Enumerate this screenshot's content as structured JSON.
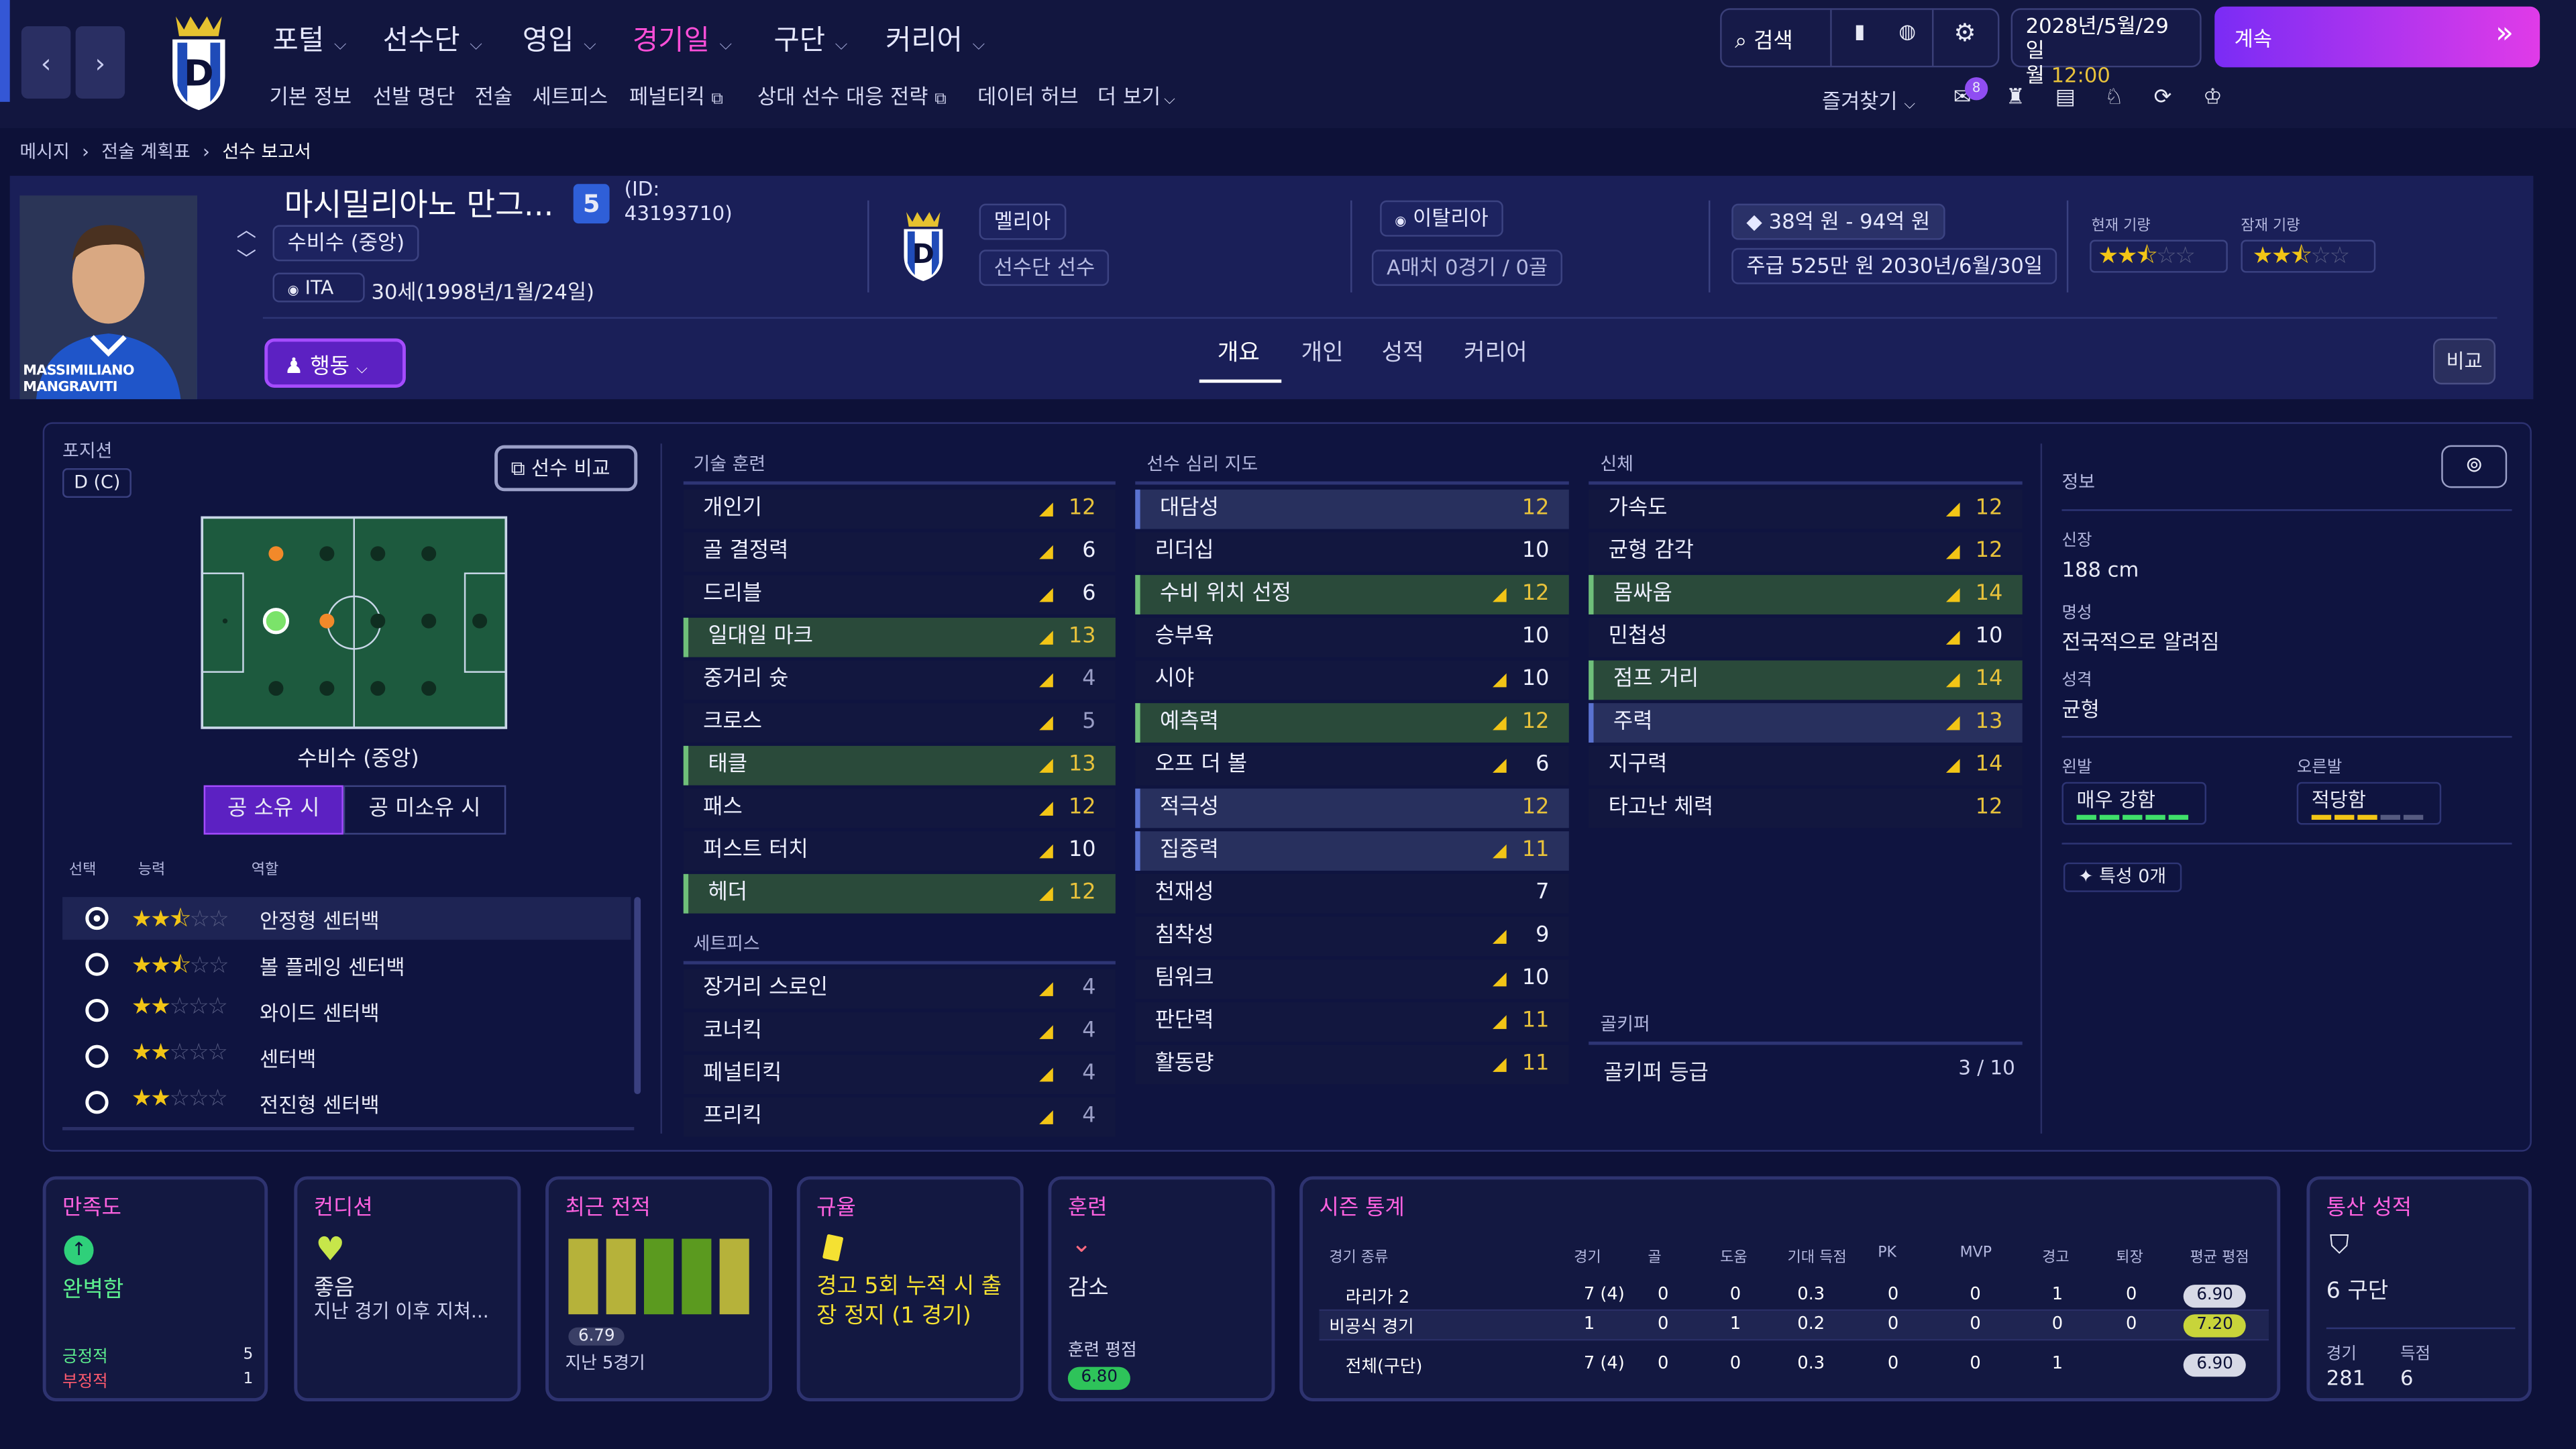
{
  "top": {
    "menus": [
      "포털",
      "선수단",
      "영입",
      "경기일",
      "구단",
      "커리어"
    ],
    "active_menu": "경기일",
    "submenus": [
      "기본 정보",
      "선발 명단",
      "전술",
      "세트피스",
      "페널티킥",
      "상대 선수 대응 전략",
      "데이터 허브",
      "더 보기"
    ],
    "search_label": "검색",
    "favorites_label": "즐겨찾기",
    "notif_count": "8",
    "date_line1": "2028년/5월/29일",
    "date_line2a": "월",
    "date_line2b": "12:00",
    "continue_label": "계속"
  },
  "breadcrumb": [
    "메시지",
    "전술 계획표",
    "선수 보고서"
  ],
  "player": {
    "name": "마시밀리아노 만그...",
    "number": "5",
    "id_label": "(ID:",
    "id_value": "43193710)",
    "position": "수비수 (중앙)",
    "nationality_code": "ITA",
    "age_birth": "30세(1998년/1월/24일)",
    "photo_caption": "MASSIMILIANO MANGRAVITI",
    "club": "멜리아",
    "club_role": "선수단 선수",
    "nation": "이탈리아",
    "caps": "A매치 0경기 / 0골",
    "value": "38억 원 - 94억 원",
    "wage": "주급 525만 원 2030년/6월/30일",
    "current_ability_label": "현재 기량",
    "potential_ability_label": "잠재 기량",
    "current_ability_stars": 2.5,
    "potential_ability_stars": 2.5,
    "action_label": "행동",
    "tabs": [
      "개요",
      "개인",
      "성적",
      "커리어"
    ],
    "active_tab": "개요",
    "compare_label": "비교"
  },
  "position_panel": {
    "title": "포지션",
    "code": "D (C)",
    "compare_button": "선수 비교",
    "position_name": "수비수 (중앙)",
    "in_possession": "공 소유 시",
    "out_possession": "공 미소유 시",
    "col_select": "선택",
    "col_ability": "능력",
    "col_role": "역할",
    "roles": [
      {
        "name": "안정형 센터백",
        "stars": 2.5,
        "selected": true
      },
      {
        "name": "볼 플레잉 센터백",
        "stars": 2.5,
        "selected": false
      },
      {
        "name": "와이드 센터백",
        "stars": 2,
        "selected": false
      },
      {
        "name": "센터백",
        "stars": 2,
        "selected": false
      },
      {
        "name": "전진형 센터백",
        "stars": 2,
        "selected": false
      }
    ]
  },
  "technical": {
    "title": "기술 훈련",
    "attrs": [
      {
        "name": "개인기",
        "value": "12",
        "trend": true,
        "hl": "none"
      },
      {
        "name": "골 결정력",
        "value": "6",
        "trend": true,
        "hl": "none"
      },
      {
        "name": "드리블",
        "value": "6",
        "trend": true,
        "hl": "none"
      },
      {
        "name": "일대일 마크",
        "value": "13",
        "trend": true,
        "hl": "green"
      },
      {
        "name": "중거리 슛",
        "value": "4",
        "trend": true,
        "hl": "none"
      },
      {
        "name": "크로스",
        "value": "5",
        "trend": true,
        "hl": "none"
      },
      {
        "name": "태클",
        "value": "13",
        "trend": true,
        "hl": "green"
      },
      {
        "name": "패스",
        "value": "12",
        "trend": true,
        "hl": "none"
      },
      {
        "name": "퍼스트 터치",
        "value": "10",
        "trend": true,
        "hl": "none"
      },
      {
        "name": "헤더",
        "value": "12",
        "trend": true,
        "hl": "green"
      }
    ],
    "setpiece_title": "세트피스",
    "setpieces": [
      {
        "name": "장거리 스로인",
        "value": "4",
        "trend": true
      },
      {
        "name": "코너킥",
        "value": "4",
        "trend": true
      },
      {
        "name": "페널티킥",
        "value": "4",
        "trend": true
      },
      {
        "name": "프리킥",
        "value": "4",
        "trend": true
      }
    ]
  },
  "mental": {
    "title": "선수 심리 지도",
    "attrs": [
      {
        "name": "대담성",
        "value": "12",
        "trend": false,
        "hl": "blue"
      },
      {
        "name": "리더십",
        "value": "10",
        "trend": false,
        "hl": "none"
      },
      {
        "name": "수비 위치 선정",
        "value": "12",
        "trend": true,
        "hl": "green"
      },
      {
        "name": "승부욕",
        "value": "10",
        "trend": false,
        "hl": "none"
      },
      {
        "name": "시야",
        "value": "10",
        "trend": true,
        "hl": "none"
      },
      {
        "name": "예측력",
        "value": "12",
        "trend": true,
        "hl": "green"
      },
      {
        "name": "오프 더 볼",
        "value": "6",
        "trend": true,
        "hl": "none"
      },
      {
        "name": "적극성",
        "value": "12",
        "trend": false,
        "hl": "blue"
      },
      {
        "name": "집중력",
        "value": "11",
        "trend": true,
        "hl": "blue"
      },
      {
        "name": "천재성",
        "value": "7",
        "trend": false,
        "hl": "none"
      },
      {
        "name": "침착성",
        "value": "9",
        "trend": true,
        "hl": "none"
      },
      {
        "name": "팀워크",
        "value": "10",
        "trend": true,
        "hl": "none"
      },
      {
        "name": "판단력",
        "value": "11",
        "trend": true,
        "hl": "none"
      },
      {
        "name": "활동량",
        "value": "11",
        "trend": true,
        "hl": "none"
      }
    ]
  },
  "physical": {
    "title": "신체",
    "attrs": [
      {
        "name": "가속도",
        "value": "12",
        "trend": true,
        "hl": "none"
      },
      {
        "name": "균형 감각",
        "value": "12",
        "trend": true,
        "hl": "none"
      },
      {
        "name": "몸싸움",
        "value": "14",
        "trend": true,
        "hl": "green"
      },
      {
        "name": "민첩성",
        "value": "10",
        "trend": true,
        "hl": "none"
      },
      {
        "name": "점프 거리",
        "value": "14",
        "trend": true,
        "hl": "green"
      },
      {
        "name": "주력",
        "value": "13",
        "trend": true,
        "hl": "blue"
      },
      {
        "name": "지구력",
        "value": "14",
        "trend": true,
        "hl": "none"
      },
      {
        "name": "타고난 체력",
        "value": "12",
        "trend": false,
        "hl": "none"
      }
    ],
    "gk_title": "골키퍼",
    "gk_label": "골키퍼 등급",
    "gk_value": "3 / 10"
  },
  "info": {
    "title": "정보",
    "height_label": "신장",
    "height": "188 cm",
    "fame_label": "명성",
    "fame": "전국적으로 알려짐",
    "personality_label": "성격",
    "personality": "균형",
    "left_foot_label": "왼발",
    "left_foot": "매우 강함",
    "left_foot_level": 5,
    "right_foot_label": "오른발",
    "right_foot": "적당함",
    "right_foot_level": 3,
    "traits": "특성 0개"
  },
  "cards": {
    "satisfaction": {
      "title": "만족도",
      "value": "완벽함",
      "pos_label": "긍정적",
      "pos": "5",
      "neg_label": "부정적",
      "neg": "1"
    },
    "condition": {
      "title": "컨디션",
      "value": "좋음",
      "note": "지난 경기 이후 지쳐..."
    },
    "form": {
      "title": "최근 전적",
      "rating": "6.79",
      "note": "지난 5경기"
    },
    "discipline": {
      "title": "규율",
      "text": "경고 5회 누적 시 출장 정지 (1 경기)"
    },
    "training": {
      "title": "훈련",
      "value": "감소",
      "rating_label": "훈련 평점",
      "rating": "6.80"
    },
    "season": {
      "title": "시즌 통계",
      "headers": [
        "경기 종류",
        "경기",
        "골",
        "도움",
        "기대 득점",
        "PK",
        "MVP",
        "경고",
        "퇴장",
        "평균 평점"
      ],
      "rows": [
        [
          "라리가 2",
          "7 (4)",
          "0",
          "0",
          "0.3",
          "0",
          "0",
          "1",
          "0",
          "6.90"
        ],
        [
          "비공식 경기",
          "1",
          "0",
          "1",
          "0.2",
          "0",
          "0",
          "0",
          "0",
          "7.20"
        ],
        [
          "전체(구단)",
          "7 (4)",
          "0",
          "0",
          "0.3",
          "0",
          "0",
          "1",
          "",
          "6.90"
        ]
      ]
    },
    "career": {
      "title": "통산 성적",
      "club": "6 구단",
      "apps_label": "경기",
      "apps": "281",
      "goals_label": "득점",
      "goals": "6"
    }
  }
}
